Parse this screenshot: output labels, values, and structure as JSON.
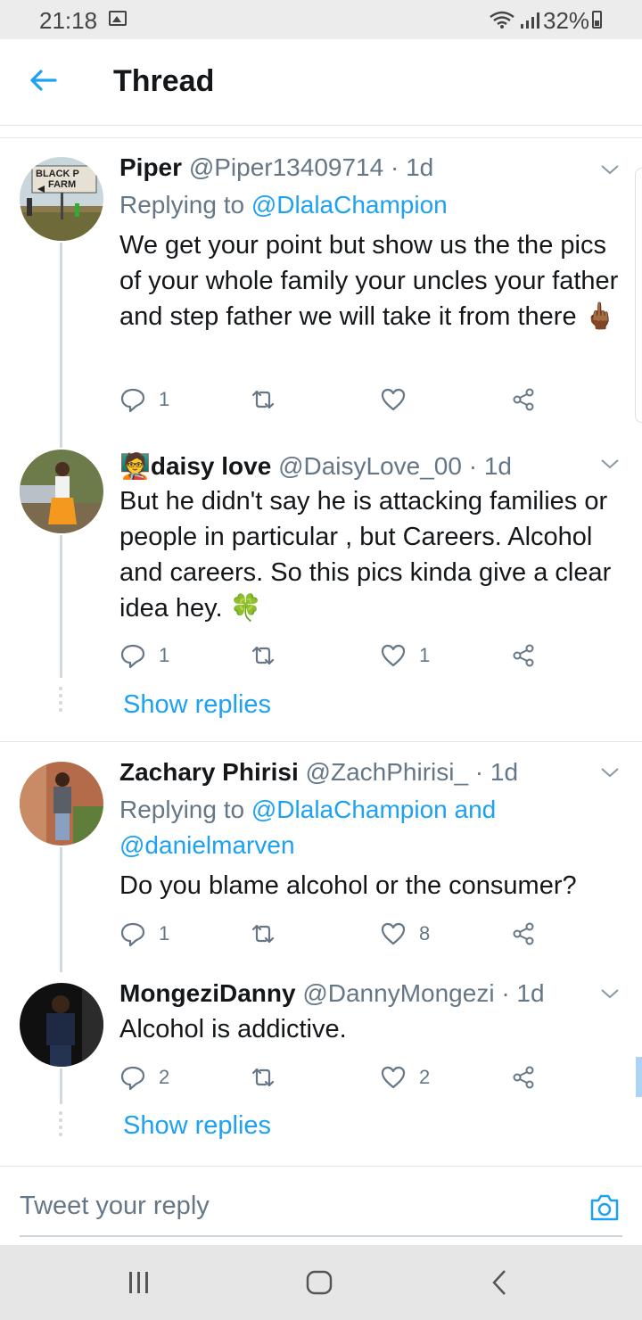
{
  "status_bar": {
    "time": "21:18",
    "battery": "32%"
  },
  "header": {
    "title": "Thread"
  },
  "tweets": [
    {
      "name": "Piper",
      "handle": "@Piper13409714 · 1d",
      "reply_prefix": "Replying to ",
      "reply_link": "@DlalaChampion",
      "reply_link2": "",
      "text": "We get your point but show us the the pics of your whole family your uncles your father and step father we will take it from there 🖕🏾",
      "replies": "1",
      "retweets": "",
      "likes": ""
    },
    {
      "name": "🧑‍🏫daisy love",
      "handle": "@DaisyLove_00 · 1d",
      "text": "But he didn't say he is attacking families or people in particular , but Careers. Alcohol and careers. So this pics kinda give a clear idea hey. 🍀",
      "replies": "1",
      "retweets": "",
      "likes": "1",
      "show_replies": "Show replies"
    },
    {
      "name": "Zachary Phirisi",
      "handle": "@ZachPhirisi_ · 1d",
      "reply_prefix": "Replying to ",
      "reply_link": "@DlalaChampion and",
      "reply_link2": "@danielmarven",
      "text": "Do you blame alcohol  or the consumer?",
      "replies": "1",
      "retweets": "",
      "likes": "8"
    },
    {
      "name": "MongeziDanny",
      "handle": "@DannyMongezi · 1d",
      "text": "Alcohol is addictive.",
      "replies": "2",
      "retweets": "",
      "likes": "2",
      "show_replies": "Show replies"
    }
  ],
  "composer": {
    "placeholder": "Tweet your reply"
  },
  "avatar_texts": {
    "piper_sign": "BLACK P… FARM"
  },
  "colors": {
    "accent": "#1da1f2",
    "muted": "#657786",
    "text": "#14171a"
  },
  "icons": [
    "back-arrow-icon",
    "reply-icon",
    "retweet-icon",
    "like-icon",
    "share-icon",
    "chevron-down-icon",
    "camera-icon",
    "recents-icon",
    "home-icon",
    "back-icon"
  ]
}
